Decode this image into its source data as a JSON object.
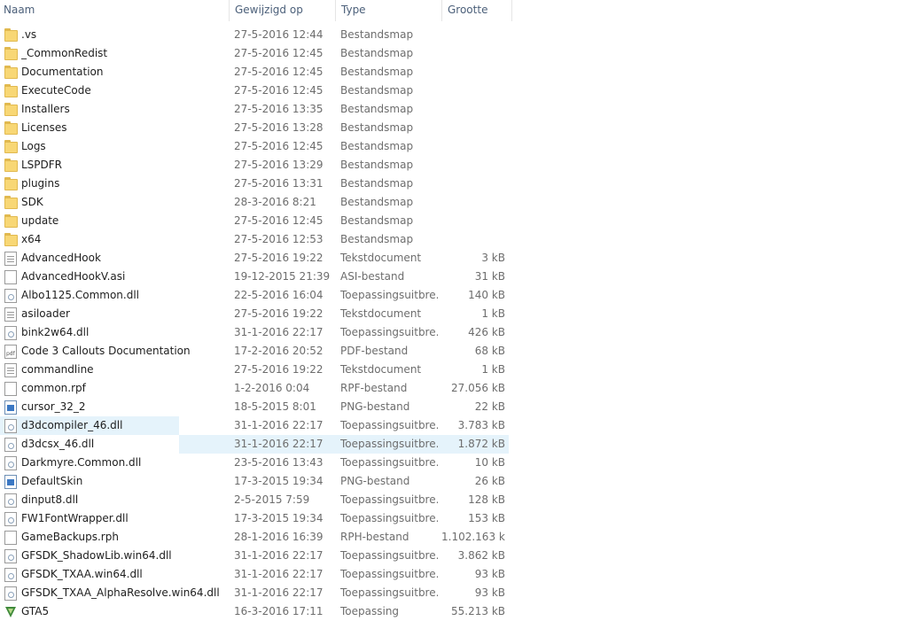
{
  "columns": {
    "name": "Naam",
    "date": "Gewijzigd op",
    "type": "Type",
    "size": "Grootte",
    "sort_indicator": "^"
  },
  "rows": [
    {
      "icon": "folder-icon",
      "name": ".vs",
      "date": "27-5-2016 12:44",
      "type": "Bestandsmap",
      "size": ""
    },
    {
      "icon": "folder-icon",
      "name": "_CommonRedist",
      "date": "27-5-2016 12:45",
      "type": "Bestandsmap",
      "size": ""
    },
    {
      "icon": "folder-icon",
      "name": "Documentation",
      "date": "27-5-2016 12:45",
      "type": "Bestandsmap",
      "size": ""
    },
    {
      "icon": "folder-icon",
      "name": "ExecuteCode",
      "date": "27-5-2016 12:45",
      "type": "Bestandsmap",
      "size": ""
    },
    {
      "icon": "folder-icon",
      "name": "Installers",
      "date": "27-5-2016 13:35",
      "type": "Bestandsmap",
      "size": ""
    },
    {
      "icon": "folder-icon",
      "name": "Licenses",
      "date": "27-5-2016 13:28",
      "type": "Bestandsmap",
      "size": ""
    },
    {
      "icon": "folder-icon",
      "name": "Logs",
      "date": "27-5-2016 12:45",
      "type": "Bestandsmap",
      "size": ""
    },
    {
      "icon": "folder-icon",
      "name": "LSPDFR",
      "date": "27-5-2016 13:29",
      "type": "Bestandsmap",
      "size": ""
    },
    {
      "icon": "folder-icon",
      "name": "plugins",
      "date": "27-5-2016 13:31",
      "type": "Bestandsmap",
      "size": ""
    },
    {
      "icon": "folder-icon",
      "name": "SDK",
      "date": "28-3-2016 8:21",
      "type": "Bestandsmap",
      "size": ""
    },
    {
      "icon": "folder-icon",
      "name": "update",
      "date": "27-5-2016 12:45",
      "type": "Bestandsmap",
      "size": ""
    },
    {
      "icon": "folder-icon",
      "name": "x64",
      "date": "27-5-2016 12:53",
      "type": "Bestandsmap",
      "size": ""
    },
    {
      "icon": "text-file-icon",
      "name": "AdvancedHook",
      "date": "27-5-2016 19:22",
      "type": "Tekstdocument",
      "size": "3 kB"
    },
    {
      "icon": "file-icon",
      "name": "AdvancedHookV.asi",
      "date": "19-12-2015 21:39",
      "type": "ASI-bestand",
      "size": "31 kB"
    },
    {
      "icon": "dll-file-icon",
      "name": "Albo1125.Common.dll",
      "date": "22-5-2016 16:04",
      "type": "Toepassingsuitbre...",
      "size": "140 kB"
    },
    {
      "icon": "text-file-icon",
      "name": "asiloader",
      "date": "27-5-2016 19:22",
      "type": "Tekstdocument",
      "size": "1 kB"
    },
    {
      "icon": "dll-file-icon",
      "name": "bink2w64.dll",
      "date": "31-1-2016 22:17",
      "type": "Toepassingsuitbre...",
      "size": "426 kB"
    },
    {
      "icon": "pdf-file-icon",
      "name": "Code 3 Callouts Documentation",
      "date": "17-2-2016 20:52",
      "type": "PDF-bestand",
      "size": "68 kB"
    },
    {
      "icon": "text-file-icon",
      "name": "commandline",
      "date": "27-5-2016 19:22",
      "type": "Tekstdocument",
      "size": "1 kB"
    },
    {
      "icon": "file-icon",
      "name": "common.rpf",
      "date": "1-2-2016 0:04",
      "type": "RPF-bestand",
      "size": "27.056 kB"
    },
    {
      "icon": "image-file-icon",
      "name": "cursor_32_2",
      "date": "18-5-2015 8:01",
      "type": "PNG-bestand",
      "size": "22 kB"
    },
    {
      "icon": "dll-file-icon",
      "name": "d3dcompiler_46.dll",
      "date": "31-1-2016 22:17",
      "type": "Toepassingsuitbre...",
      "size": "3.783 kB",
      "hover": "name"
    },
    {
      "icon": "dll-file-icon",
      "name": "d3dcsx_46.dll",
      "date": "31-1-2016 22:17",
      "type": "Toepassingsuitbre...",
      "size": "1.872 kB",
      "hover": "rest"
    },
    {
      "icon": "dll-file-icon",
      "name": "Darkmyre.Common.dll",
      "date": "23-5-2016 13:43",
      "type": "Toepassingsuitbre...",
      "size": "10 kB"
    },
    {
      "icon": "image-file-icon",
      "name": "DefaultSkin",
      "date": "17-3-2015 19:34",
      "type": "PNG-bestand",
      "size": "26 kB"
    },
    {
      "icon": "dll-file-icon",
      "name": "dinput8.dll",
      "date": "2-5-2015 7:59",
      "type": "Toepassingsuitbre...",
      "size": "128 kB"
    },
    {
      "icon": "dll-file-icon",
      "name": "FW1FontWrapper.dll",
      "date": "17-3-2015 19:34",
      "type": "Toepassingsuitbre...",
      "size": "153 kB"
    },
    {
      "icon": "file-icon",
      "name": "GameBackups.rph",
      "date": "28-1-2016 16:39",
      "type": "RPH-bestand",
      "size": "1.102.163 kB"
    },
    {
      "icon": "dll-file-icon",
      "name": "GFSDK_ShadowLib.win64.dll",
      "date": "31-1-2016 22:17",
      "type": "Toepassingsuitbre...",
      "size": "3.862 kB"
    },
    {
      "icon": "dll-file-icon",
      "name": "GFSDK_TXAA.win64.dll",
      "date": "31-1-2016 22:17",
      "type": "Toepassingsuitbre...",
      "size": "93 kB"
    },
    {
      "icon": "dll-file-icon",
      "name": "GFSDK_TXAA_AlphaResolve.win64.dll",
      "date": "31-1-2016 22:17",
      "type": "Toepassingsuitbre...",
      "size": "93 kB"
    },
    {
      "icon": "gta-app-icon",
      "name": "GTA5",
      "date": "16-3-2016 17:11",
      "type": "Toepassing",
      "size": "55.213 kB"
    }
  ]
}
